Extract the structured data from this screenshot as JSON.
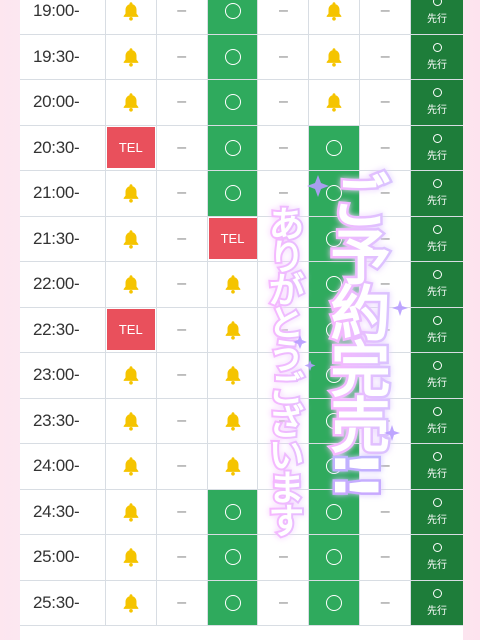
{
  "schedule": {
    "rows": [
      {
        "time": "19:00-",
        "cells": [
          "bell",
          "dash",
          "circle",
          "dash",
          "bell",
          "dash",
          "senko"
        ]
      },
      {
        "time": "19:30-",
        "cells": [
          "bell",
          "dash",
          "circle",
          "dash",
          "bell",
          "dash",
          "senko"
        ]
      },
      {
        "time": "20:00-",
        "cells": [
          "bell",
          "dash",
          "circle",
          "dash",
          "bell",
          "dash",
          "senko"
        ]
      },
      {
        "time": "20:30-",
        "cells": [
          "tel",
          "dash",
          "circle",
          "dash",
          "circle",
          "dash",
          "senko"
        ]
      },
      {
        "time": "21:00-",
        "cells": [
          "bell",
          "dash",
          "circle",
          "dash",
          "circle",
          "dash",
          "senko"
        ]
      },
      {
        "time": "21:30-",
        "cells": [
          "bell",
          "dash",
          "tel",
          "dash",
          "circle",
          "dash",
          "senko"
        ]
      },
      {
        "time": "22:00-",
        "cells": [
          "bell",
          "dash",
          "bell",
          "dash",
          "circle",
          "dash",
          "senko"
        ]
      },
      {
        "time": "22:30-",
        "cells": [
          "tel",
          "dash",
          "bell",
          "dash",
          "circle",
          "dash",
          "senko"
        ]
      },
      {
        "time": "23:00-",
        "cells": [
          "bell",
          "dash",
          "bell",
          "dash",
          "circle",
          "dash",
          "senko"
        ]
      },
      {
        "time": "23:30-",
        "cells": [
          "bell",
          "dash",
          "bell",
          "dash",
          "circle",
          "dash",
          "senko"
        ]
      },
      {
        "time": "24:00-",
        "cells": [
          "bell",
          "dash",
          "bell",
          "dash",
          "circle",
          "dash",
          "senko"
        ]
      },
      {
        "time": "24:30-",
        "cells": [
          "bell",
          "dash",
          "circle",
          "dash",
          "circle",
          "dash",
          "senko"
        ]
      },
      {
        "time": "25:00-",
        "cells": [
          "bell",
          "dash",
          "circle",
          "dash",
          "circle",
          "dash",
          "senko"
        ]
      },
      {
        "time": "25:30-",
        "cells": [
          "bell",
          "dash",
          "circle",
          "dash",
          "circle",
          "dash",
          "senko"
        ]
      }
    ]
  },
  "labels": {
    "tel": "TEL",
    "dash": "–",
    "senko": "先行"
  },
  "overlay": {
    "line1": "ご予約完売!!",
    "line2": "ありがとうございます"
  },
  "colors": {
    "green": "#2faa5d",
    "dark_green": "#1e7d3a",
    "tel_red": "#e9505c",
    "bell_yellow": "#f5c400"
  }
}
